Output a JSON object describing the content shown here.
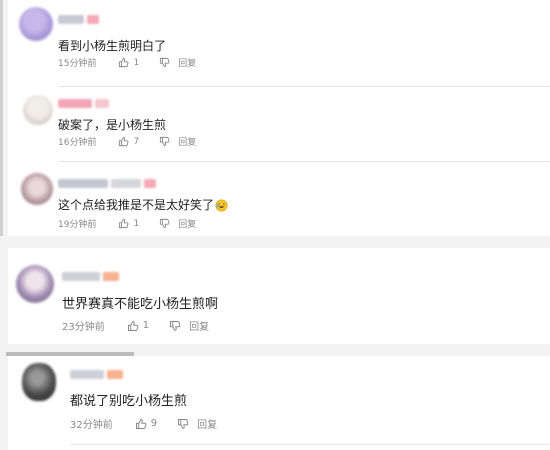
{
  "comments": [
    {
      "text": "看到小杨生煎明白了",
      "time": "15分钟前",
      "likes": "1",
      "reply": "回复"
    },
    {
      "text": "破案了，是小杨生煎",
      "time": "16分钟前",
      "likes": "7",
      "reply": "回复"
    },
    {
      "text": "这个点给我推是不是太好笑了",
      "time": "19分钟前",
      "likes": "1",
      "reply": "回复",
      "emoji": "laughing-crying-emoji"
    },
    {
      "text": "世界赛真不能吃小杨生煎啊",
      "time": "23分钟前",
      "likes": "1",
      "reply": "回复"
    },
    {
      "text": "都说了别吃小杨生煎",
      "time": "32分钟前",
      "likes": "9",
      "reply": "回复"
    }
  ],
  "colors": {
    "background": "#f3f3f3",
    "card": "#ffffff",
    "text": "#222222",
    "meta": "#888888",
    "username_blur": "#c9c9d6",
    "badge_pink": "#f6a9b6",
    "badge_orange": "#f7b18f"
  },
  "icons": {
    "like": "thumb-up-icon",
    "dislike": "thumb-down-icon"
  }
}
